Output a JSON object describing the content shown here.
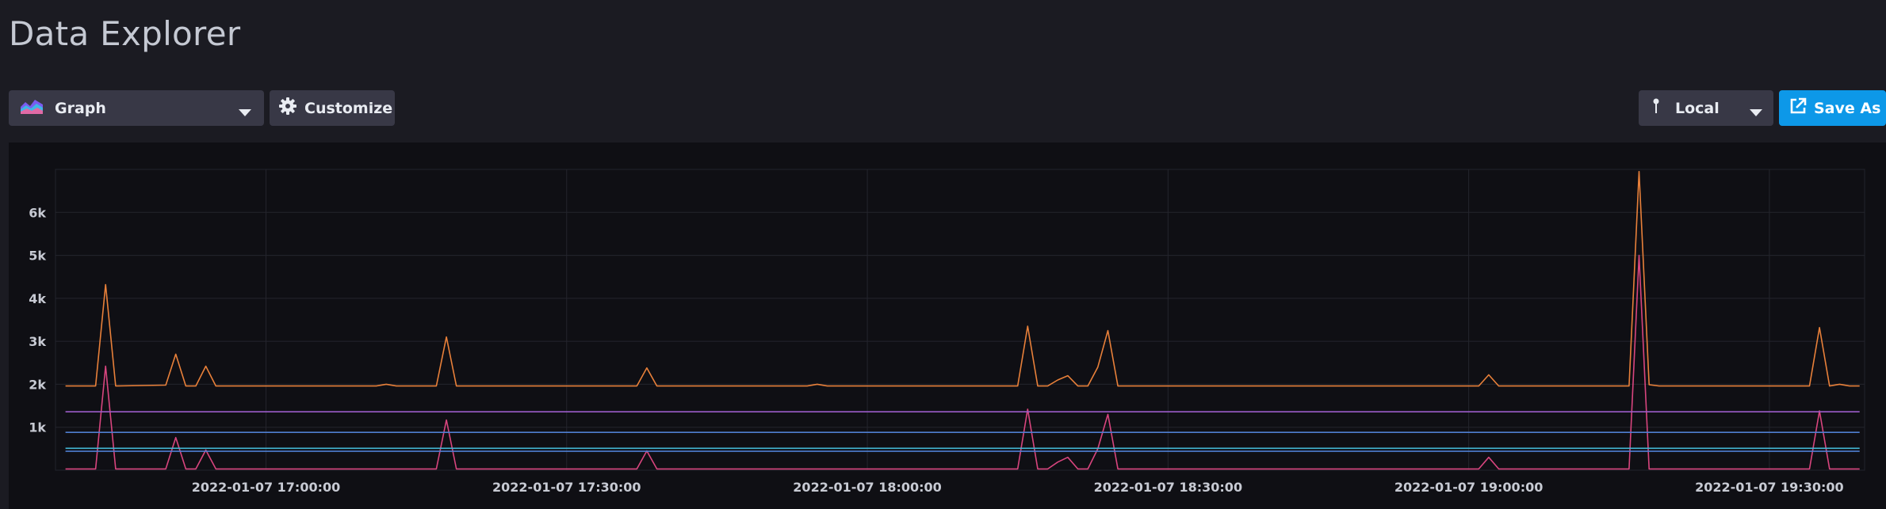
{
  "page": {
    "title": "Data Explorer"
  },
  "toolbar": {
    "graph_select_label": "Graph",
    "customize_label": "Customize",
    "timezone_label": "Local",
    "save_as_label": "Save As"
  },
  "colors": {
    "orange": "#e8803a",
    "magenta": "#d8457e",
    "purple": "#9c5cc9",
    "blue": "#4f7fd1",
    "cyan": "#43b8d6",
    "accent": "#0d98e8"
  },
  "icons": {
    "graph": "area-graph-icon",
    "customize": "gear-icon",
    "timezone": "pin-icon",
    "save_as": "external-link-icon",
    "caret": "chevron-down-icon"
  },
  "chart_data": {
    "type": "line",
    "title": "",
    "xlabel": "",
    "ylabel": "",
    "ylim": [
      0,
      7000
    ],
    "xlim": [
      "2022-01-07 16:39:00",
      "2022-01-07 19:39:30"
    ],
    "grid": true,
    "y_ticks": [
      {
        "value": 1000,
        "label": "1k"
      },
      {
        "value": 2000,
        "label": "2k"
      },
      {
        "value": 3000,
        "label": "3k"
      },
      {
        "value": 4000,
        "label": "4k"
      },
      {
        "value": 5000,
        "label": "5k"
      },
      {
        "value": 6000,
        "label": "6k"
      }
    ],
    "x_ticks": [
      {
        "value": "2022-01-07 17:00:00",
        "label": "2022-01-07 17:00:00"
      },
      {
        "value": "2022-01-07 17:30:00",
        "label": "2022-01-07 17:30:00"
      },
      {
        "value": "2022-01-07 18:00:00",
        "label": "2022-01-07 18:00:00"
      },
      {
        "value": "2022-01-07 18:30:00",
        "label": "2022-01-07 18:30:00"
      },
      {
        "value": "2022-01-07 19:00:00",
        "label": "2022-01-07 19:00:00"
      },
      {
        "value": "2022-01-07 19:30:00",
        "label": "2022-01-07 19:30:00"
      }
    ],
    "series": [
      {
        "color": "#e8803a",
        "points": [
          [
            "2022-01-07 16:40:00",
            1960
          ],
          [
            "2022-01-07 16:43:00",
            1960
          ],
          [
            "2022-01-07 16:44:00",
            4320
          ],
          [
            "2022-01-07 16:45:00",
            1960
          ],
          [
            "2022-01-07 16:50:00",
            1980
          ],
          [
            "2022-01-07 16:51:00",
            2700
          ],
          [
            "2022-01-07 16:52:00",
            1960
          ],
          [
            "2022-01-07 16:53:00",
            1960
          ],
          [
            "2022-01-07 16:54:00",
            2420
          ],
          [
            "2022-01-07 16:55:00",
            1960
          ],
          [
            "2022-01-07 17:11:00",
            1960
          ],
          [
            "2022-01-07 17:12:00",
            2000
          ],
          [
            "2022-01-07 17:13:00",
            1960
          ],
          [
            "2022-01-07 17:17:00",
            1960
          ],
          [
            "2022-01-07 17:18:00",
            3100
          ],
          [
            "2022-01-07 17:19:00",
            1960
          ],
          [
            "2022-01-07 17:37:00",
            1960
          ],
          [
            "2022-01-07 17:38:00",
            2380
          ],
          [
            "2022-01-07 17:39:00",
            1960
          ],
          [
            "2022-01-07 17:54:00",
            1960
          ],
          [
            "2022-01-07 17:55:00",
            2000
          ],
          [
            "2022-01-07 17:56:00",
            1960
          ],
          [
            "2022-01-07 18:15:00",
            1960
          ],
          [
            "2022-01-07 18:16:00",
            3350
          ],
          [
            "2022-01-07 18:17:00",
            1960
          ],
          [
            "2022-01-07 18:18:00",
            1960
          ],
          [
            "2022-01-07 18:19:00",
            2100
          ],
          [
            "2022-01-07 18:20:00",
            2200
          ],
          [
            "2022-01-07 18:21:00",
            1960
          ],
          [
            "2022-01-07 18:22:00",
            1960
          ],
          [
            "2022-01-07 18:23:00",
            2400
          ],
          [
            "2022-01-07 18:24:00",
            3250
          ],
          [
            "2022-01-07 18:25:00",
            1960
          ],
          [
            "2022-01-07 19:01:00",
            1960
          ],
          [
            "2022-01-07 19:02:00",
            2220
          ],
          [
            "2022-01-07 19:03:00",
            1960
          ],
          [
            "2022-01-07 19:16:00",
            1960
          ],
          [
            "2022-01-07 19:17:00",
            6950
          ],
          [
            "2022-01-07 19:18:00",
            1990
          ],
          [
            "2022-01-07 19:19:00",
            1960
          ],
          [
            "2022-01-07 19:34:00",
            1960
          ],
          [
            "2022-01-07 19:35:00",
            3320
          ],
          [
            "2022-01-07 19:36:00",
            1960
          ],
          [
            "2022-01-07 19:37:00",
            2000
          ],
          [
            "2022-01-07 19:38:00",
            1960
          ],
          [
            "2022-01-07 19:39:00",
            1960
          ]
        ]
      },
      {
        "color": "#d8457e",
        "points": [
          [
            "2022-01-07 16:40:00",
            30
          ],
          [
            "2022-01-07 16:43:00",
            30
          ],
          [
            "2022-01-07 16:44:00",
            2420
          ],
          [
            "2022-01-07 16:45:00",
            30
          ],
          [
            "2022-01-07 16:50:00",
            30
          ],
          [
            "2022-01-07 16:51:00",
            760
          ],
          [
            "2022-01-07 16:52:00",
            30
          ],
          [
            "2022-01-07 16:53:00",
            30
          ],
          [
            "2022-01-07 16:54:00",
            470
          ],
          [
            "2022-01-07 16:55:00",
            30
          ],
          [
            "2022-01-07 17:17:00",
            30
          ],
          [
            "2022-01-07 17:18:00",
            1170
          ],
          [
            "2022-01-07 17:19:00",
            30
          ],
          [
            "2022-01-07 17:37:00",
            30
          ],
          [
            "2022-01-07 17:38:00",
            450
          ],
          [
            "2022-01-07 17:39:00",
            30
          ],
          [
            "2022-01-07 18:15:00",
            30
          ],
          [
            "2022-01-07 18:16:00",
            1420
          ],
          [
            "2022-01-07 18:17:00",
            30
          ],
          [
            "2022-01-07 18:18:00",
            30
          ],
          [
            "2022-01-07 18:19:00",
            190
          ],
          [
            "2022-01-07 18:20:00",
            300
          ],
          [
            "2022-01-07 18:21:00",
            30
          ],
          [
            "2022-01-07 18:22:00",
            30
          ],
          [
            "2022-01-07 18:23:00",
            500
          ],
          [
            "2022-01-07 18:24:00",
            1300
          ],
          [
            "2022-01-07 18:25:00",
            30
          ],
          [
            "2022-01-07 19:01:00",
            30
          ],
          [
            "2022-01-07 19:02:00",
            300
          ],
          [
            "2022-01-07 19:03:00",
            30
          ],
          [
            "2022-01-07 19:16:00",
            30
          ],
          [
            "2022-01-07 19:17:00",
            5000
          ],
          [
            "2022-01-07 19:18:00",
            30
          ],
          [
            "2022-01-07 19:34:00",
            30
          ],
          [
            "2022-01-07 19:35:00",
            1380
          ],
          [
            "2022-01-07 19:36:00",
            30
          ],
          [
            "2022-01-07 19:39:00",
            30
          ]
        ]
      },
      {
        "color": "#9c5cc9",
        "points": [
          [
            "2022-01-07 16:40:00",
            1360
          ],
          [
            "2022-01-07 19:39:00",
            1360
          ]
        ]
      },
      {
        "color": "#4f7fd1",
        "points": [
          [
            "2022-01-07 16:40:00",
            880
          ],
          [
            "2022-01-07 19:39:00",
            880
          ]
        ]
      },
      {
        "color": "#43b8d6",
        "points": [
          [
            "2022-01-07 16:40:00",
            510
          ],
          [
            "2022-01-07 19:39:00",
            510
          ]
        ]
      },
      {
        "color": "#4f7fd1",
        "points": [
          [
            "2022-01-07 16:40:00",
            440
          ],
          [
            "2022-01-07 19:39:00",
            440
          ]
        ]
      }
    ]
  }
}
